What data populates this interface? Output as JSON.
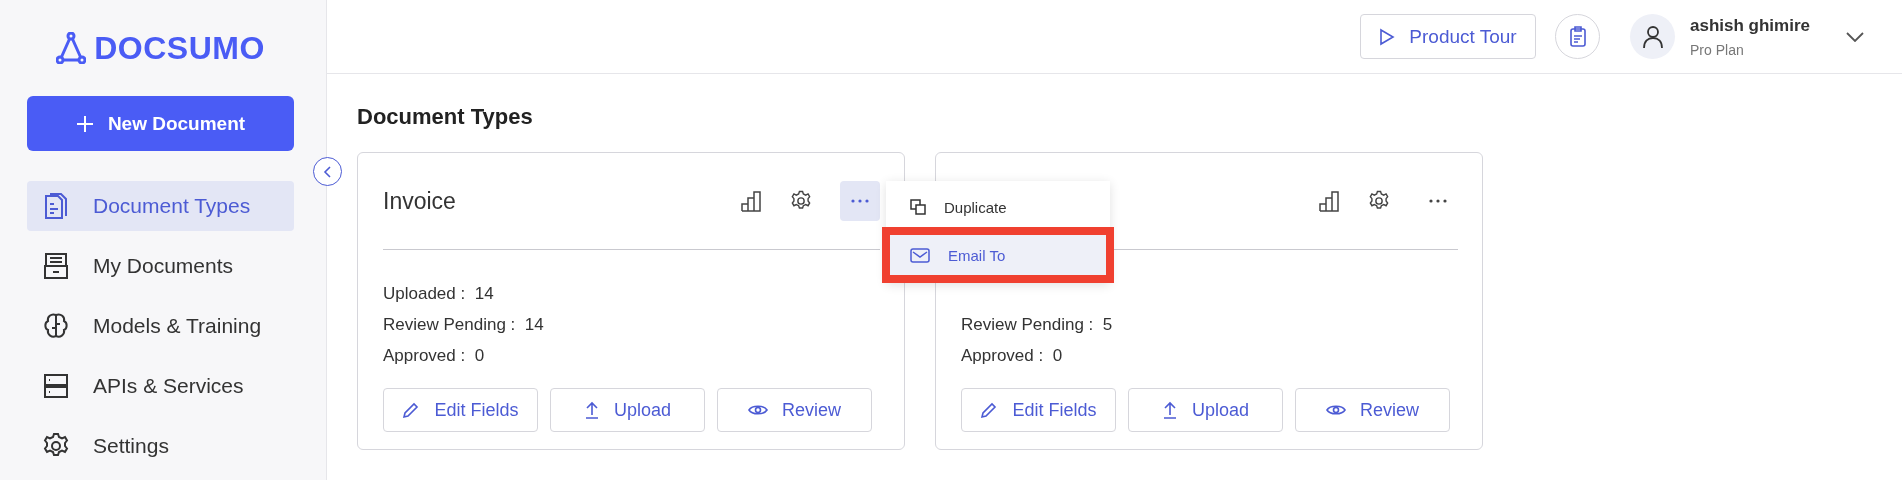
{
  "sidebar": {
    "logo": "DOCSUMO",
    "new_button": "New Document",
    "items": [
      {
        "label": "Document Types",
        "kind": "doc",
        "selected": true
      },
      {
        "label": "My Documents",
        "kind": "drawer",
        "selected": false
      },
      {
        "label": "Models & Training",
        "kind": "brain",
        "selected": false
      },
      {
        "label": "APIs & Services",
        "kind": "server",
        "selected": false
      },
      {
        "label": "Settings",
        "kind": "gear",
        "selected": false
      }
    ]
  },
  "header": {
    "tour_button": "Product Tour",
    "user": {
      "name": "ashish ghimire",
      "plan": "Pro Plan"
    }
  },
  "page_title": "Document Types",
  "cards": [
    {
      "title": "Invoice",
      "menu_open": true,
      "stats": [
        {
          "label": "Uploaded :",
          "value": "14"
        },
        {
          "label": "Review Pending :",
          "value": "14"
        },
        {
          "label": "Approved :",
          "value": "0"
        }
      ],
      "actions": [
        {
          "label": "Edit Fields",
          "kind": "pencil"
        },
        {
          "label": "Upload",
          "kind": "upload"
        },
        {
          "label": "Review",
          "kind": "eye"
        }
      ]
    },
    {
      "menu_open": false,
      "stats": [
        {
          "label": "Review Pending :",
          "value": "5"
        },
        {
          "label": "Approved :",
          "value": "0"
        }
      ],
      "actions": [
        {
          "label": "Edit Fields",
          "kind": "pencil"
        },
        {
          "label": "Upload",
          "kind": "upload"
        },
        {
          "label": "Review",
          "kind": "eye"
        }
      ]
    }
  ],
  "menu": {
    "items": [
      {
        "label": "Duplicate",
        "kind": "copy",
        "highlighted": false
      },
      {
        "label": "Email To",
        "kind": "mail",
        "highlighted": true
      }
    ]
  }
}
